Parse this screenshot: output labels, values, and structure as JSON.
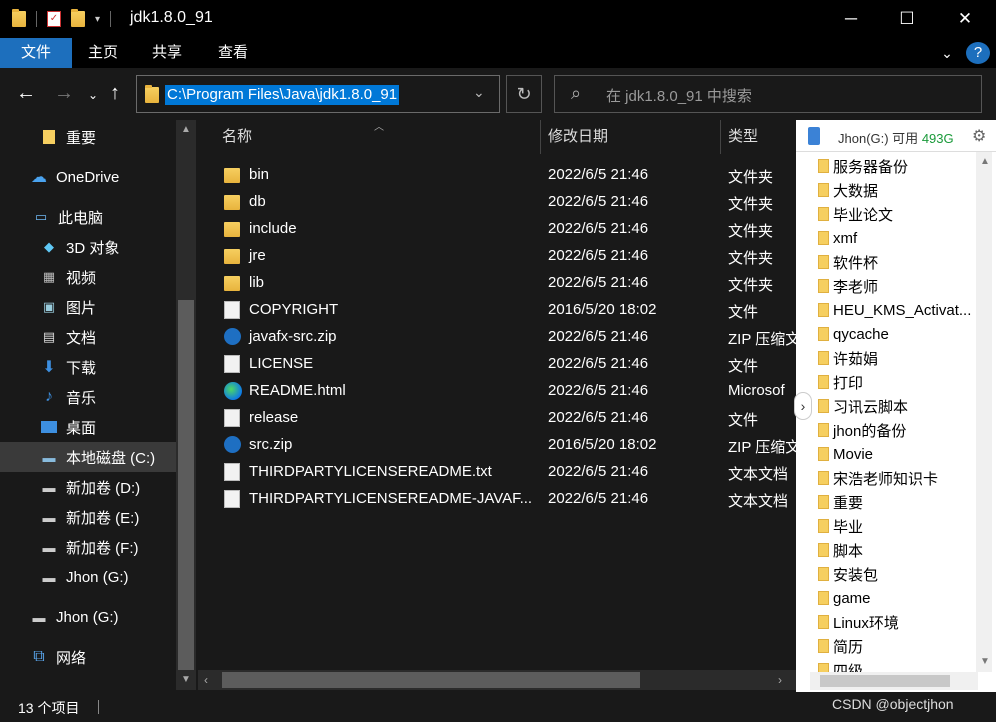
{
  "window": {
    "title": "jdk1.8.0_91",
    "minimize": "─",
    "maximize": "☐",
    "close": "✕"
  },
  "ribbon": {
    "tabs": [
      "文件",
      "主页",
      "共享",
      "查看"
    ],
    "expand": "⌄",
    "help": "?"
  },
  "address": {
    "path": "C:\\Program Files\\Java\\jdk1.8.0_91",
    "search_placeholder": "在 jdk1.8.0_91 中搜索"
  },
  "nav": {
    "items": [
      {
        "label": "重要",
        "icon": "folder-icon"
      },
      {
        "label": "OneDrive",
        "icon": "cloud-icon"
      },
      {
        "label": "此电脑",
        "icon": "computer-icon"
      },
      {
        "label": "3D 对象",
        "icon": "cube-icon"
      },
      {
        "label": "视频",
        "icon": "video-icon"
      },
      {
        "label": "图片",
        "icon": "picture-icon"
      },
      {
        "label": "文档",
        "icon": "document-icon"
      },
      {
        "label": "下载",
        "icon": "download-icon"
      },
      {
        "label": "音乐",
        "icon": "music-icon"
      },
      {
        "label": "桌面",
        "icon": "desktop-icon"
      },
      {
        "label": "本地磁盘 (C:)",
        "icon": "drive-icon"
      },
      {
        "label": "新加卷 (D:)",
        "icon": "drive-icon"
      },
      {
        "label": "新加卷 (E:)",
        "icon": "drive-icon"
      },
      {
        "label": "新加卷 (F:)",
        "icon": "drive-icon"
      },
      {
        "label": "Jhon (G:)",
        "icon": "usb-drive-icon"
      },
      {
        "label": "Jhon (G:)",
        "icon": "usb-drive-icon"
      },
      {
        "label": "网络",
        "icon": "network-icon"
      }
    ]
  },
  "files": {
    "columns": {
      "name": "名称",
      "date": "修改日期",
      "type": "类型"
    },
    "rows": [
      {
        "name": "bin",
        "date": "2022/6/5 21:46",
        "type": "文件夹",
        "icon": "folder"
      },
      {
        "name": "db",
        "date": "2022/6/5 21:46",
        "type": "文件夹",
        "icon": "folder"
      },
      {
        "name": "include",
        "date": "2022/6/5 21:46",
        "type": "文件夹",
        "icon": "folder"
      },
      {
        "name": "jre",
        "date": "2022/6/5 21:46",
        "type": "文件夹",
        "icon": "folder"
      },
      {
        "name": "lib",
        "date": "2022/6/5 21:46",
        "type": "文件夹",
        "icon": "folder"
      },
      {
        "name": "COPYRIGHT",
        "date": "2016/5/20 18:02",
        "type": "文件",
        "icon": "doc"
      },
      {
        "name": "javafx-src.zip",
        "date": "2022/6/5 21:46",
        "type": "ZIP 压缩文",
        "icon": "zip"
      },
      {
        "name": "LICENSE",
        "date": "2022/6/5 21:46",
        "type": "文件",
        "icon": "doc"
      },
      {
        "name": "README.html",
        "date": "2022/6/5 21:46",
        "type": "Microsof",
        "icon": "edge"
      },
      {
        "name": "release",
        "date": "2022/6/5 21:46",
        "type": "文件",
        "icon": "doc"
      },
      {
        "name": "src.zip",
        "date": "2016/5/20 18:02",
        "type": "ZIP 压缩文",
        "icon": "zip"
      },
      {
        "name": "THIRDPARTYLICENSEREADME.txt",
        "date": "2022/6/5 21:46",
        "type": "文本文档",
        "icon": "doc"
      },
      {
        "name": "THIRDPARTYLICENSEREADME-JAVAF...",
        "date": "2022/6/5 21:46",
        "type": "文本文档",
        "icon": "doc"
      }
    ]
  },
  "panel": {
    "drive": "Jhon(G:) 可用",
    "free": "493G",
    "items": [
      "服务器备份",
      "大数据",
      "毕业论文",
      "xmf",
      "软件杯",
      "李老师",
      "HEU_KMS_Activat...",
      "qycache",
      "许茹娟",
      "打印",
      "习讯云脚本",
      "jhon的备份",
      "Movie",
      "宋浩老师知识卡",
      "重要",
      "毕业",
      "脚本",
      "安装包",
      "game",
      "Linux环境",
      "简历",
      "四级"
    ]
  },
  "status": {
    "count": "13 个项目",
    "watermark": "CSDN @objectjhon"
  }
}
